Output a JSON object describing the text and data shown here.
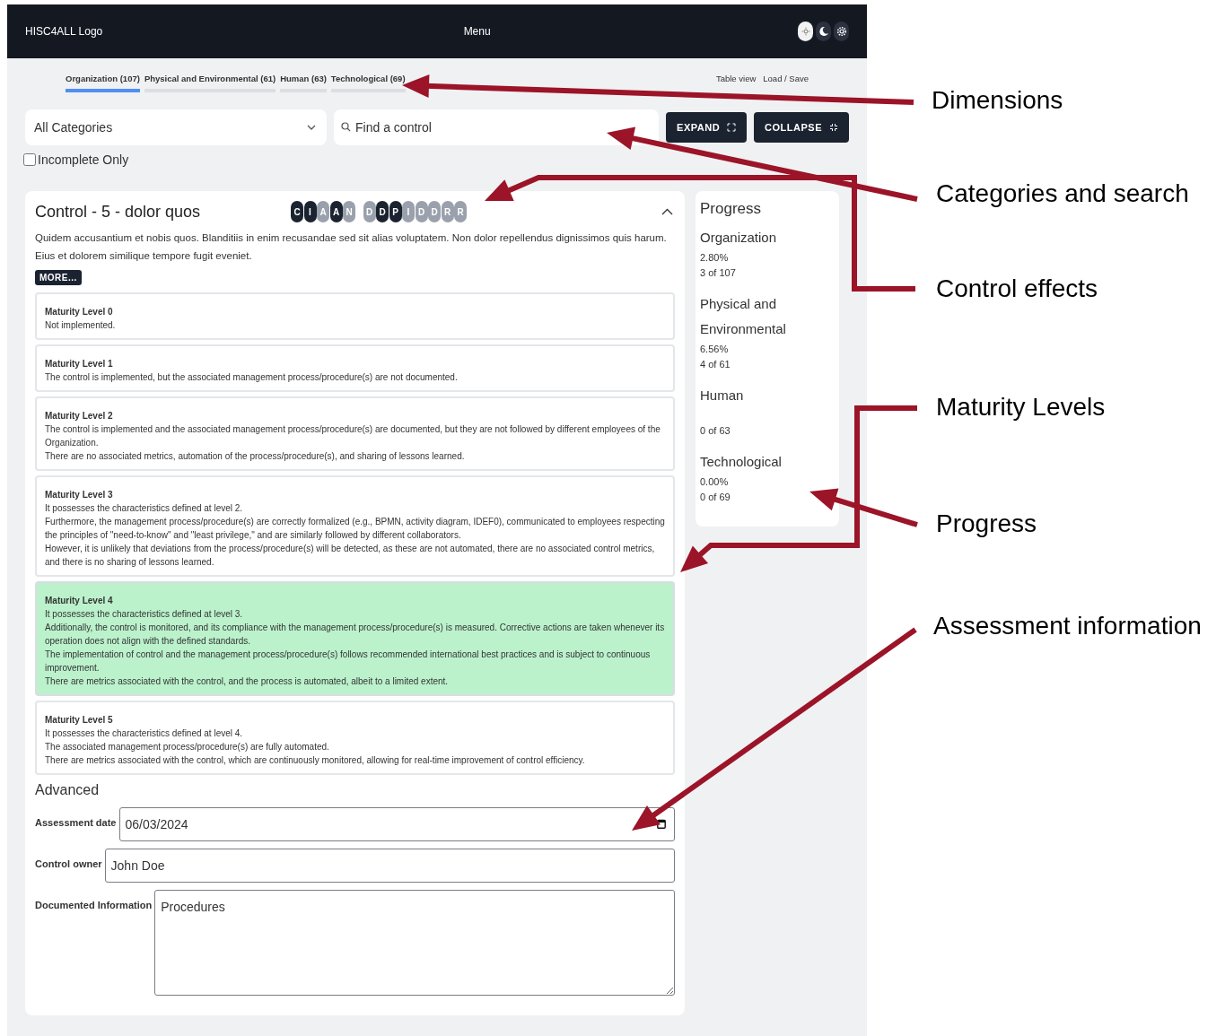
{
  "navbar": {
    "logo": "HISC4ALL Logo",
    "menu": "Menu",
    "theme_buttons": [
      {
        "kind": "light",
        "selected": true
      },
      {
        "kind": "dark",
        "selected": false
      }
    ]
  },
  "dimension_tabs": [
    {
      "label": "Organization (107)",
      "selected": true
    },
    {
      "label": "Physical and Environmental (61)",
      "selected": false
    },
    {
      "label": "Human (63)",
      "selected": false
    },
    {
      "label": "Technological (69)",
      "selected": false
    }
  ],
  "view_links": [
    "Table view",
    "Load / Save"
  ],
  "category_select": {
    "value": "All Categories"
  },
  "search": {
    "placeholder": "Find a control"
  },
  "buttons": [
    {
      "label": "EXPAND",
      "kind": "expand"
    },
    {
      "label": "COLLAPSE",
      "kind": "collapse"
    }
  ],
  "incomplete_only": {
    "label": "Incomplete Only",
    "checked": false
  },
  "control": {
    "title": "Control - 5 - dolor quos",
    "expanded": true,
    "effect_groups": [
      [
        {
          "letter": "C",
          "active": true
        },
        {
          "letter": "I",
          "active": true
        },
        {
          "letter": "A",
          "active": false
        },
        {
          "letter": "A",
          "active": true
        },
        {
          "letter": "N",
          "active": false
        }
      ],
      [
        {
          "letter": "D",
          "active": false
        },
        {
          "letter": "D",
          "active": true
        },
        {
          "letter": "P",
          "active": true
        },
        {
          "letter": "I",
          "active": false
        },
        {
          "letter": "D",
          "active": false
        },
        {
          "letter": "D",
          "active": false
        },
        {
          "letter": "R",
          "active": false
        },
        {
          "letter": "R",
          "active": false
        }
      ]
    ],
    "description": "Quidem accusantium et nobis quos. Blanditiis in enim recusandae sed sit alias voluptatem. Non dolor repellendus dignissimos quis harum. Eius et dolorem similique tempore fugit eveniet.",
    "more_button": "MORE...",
    "maturity_levels": [
      {
        "title": "Maturity Level 0",
        "selected": false,
        "lines": [
          "Not implemented."
        ]
      },
      {
        "title": "Maturity Level 1",
        "selected": false,
        "lines": [
          "The control is implemented, but the associated management process/procedure(s) are not documented."
        ]
      },
      {
        "title": "Maturity Level 2",
        "selected": false,
        "lines": [
          "The control is implemented and the associated management process/procedure(s) are documented, but they are not followed by different employees of the Organization.",
          "There are no associated metrics, automation of the process/procedure(s), and sharing of lessons learned."
        ]
      },
      {
        "title": "Maturity Level 3",
        "selected": false,
        "lines": [
          "It possesses the characteristics defined at level 2.",
          "Furthermore, the management process/procedure(s) are correctly formalized (e.g., BPMN, activity diagram, IDEF0), communicated to employees respecting the principles of \"need-to-know\" and \"least privilege,\" and are similarly followed by different collaborators.",
          "However, it is unlikely that deviations from the process/procedure(s) will be detected, as these are not automated, there are no associated control metrics, and there is no sharing of lessons learned."
        ]
      },
      {
        "title": "Maturity Level 4",
        "selected": true,
        "lines": [
          "It possesses the characteristics defined at level 3.",
          "Additionally, the control is monitored, and its compliance with the management process/procedure(s) is measured. Corrective actions are taken whenever its operation does not align with the defined standards.",
          "The implementation of control and the management process/procedure(s) follows recommended international best practices and is subject to continuous improvement.",
          "There are metrics associated with the control, and the process is automated, albeit to a limited extent."
        ]
      },
      {
        "title": "Maturity Level 5",
        "selected": false,
        "lines": [
          "It possesses the characteristics defined at level 4.",
          "The associated management process/procedure(s) are fully automated.",
          "There are metrics associated with the control, which are continuously monitored, allowing for real-time improvement of control efficiency."
        ]
      }
    ]
  },
  "advanced": {
    "title": "Advanced",
    "fields": [
      {
        "label": "Assessment date",
        "value": "06/03/2024",
        "kind": "date"
      },
      {
        "label": "Control owner",
        "value": "John Doe",
        "kind": "text"
      },
      {
        "label": "Documented Information",
        "value": "Procedures",
        "kind": "textarea"
      }
    ]
  },
  "progress": {
    "title": "Progress",
    "items": [
      {
        "name": "Organization",
        "percent": "2.80%",
        "count": "3 of 107"
      },
      {
        "name": "Physical and Environmental",
        "percent": "6.56%",
        "count": "4 of 61"
      },
      {
        "name": "Human",
        "count": "0 of 63"
      },
      {
        "name": "Technological",
        "percent": "0.00%",
        "count": "0 of 69"
      }
    ]
  },
  "annotations": [
    {
      "label": "Dimensions"
    },
    {
      "label": "Categories and search"
    },
    {
      "label": "Control effects"
    },
    {
      "label": "Maturity Levels"
    },
    {
      "label": "Progress"
    },
    {
      "label": "Assessment information"
    }
  ]
}
